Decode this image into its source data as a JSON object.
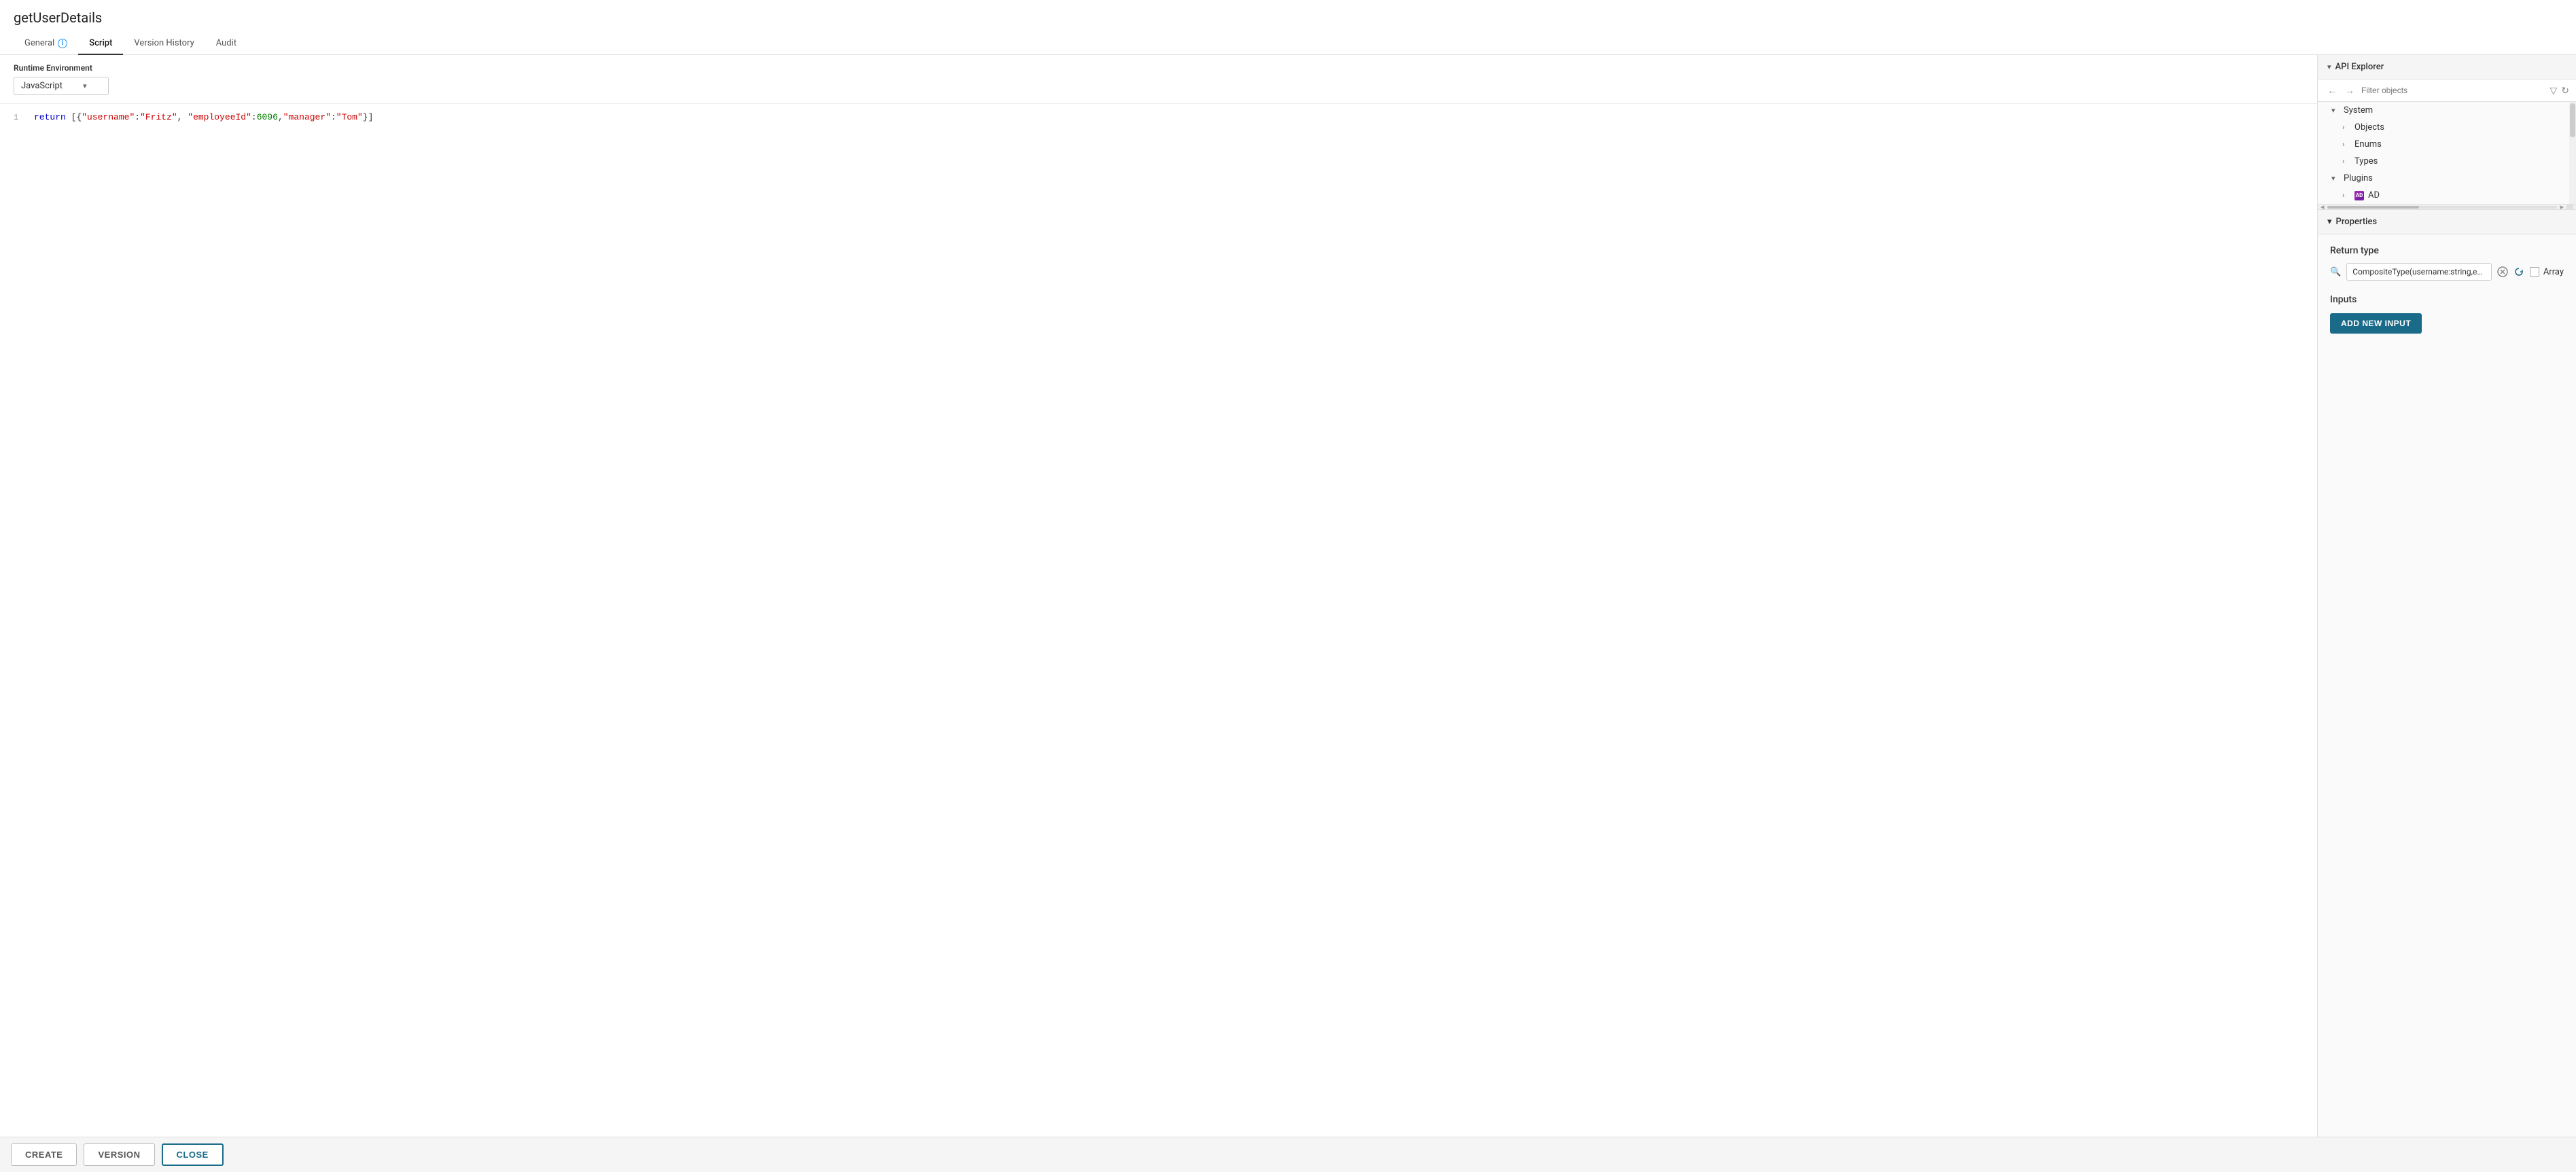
{
  "page": {
    "title": "getUserDetails"
  },
  "tabs": [
    {
      "id": "general",
      "label": "General",
      "hasInfo": true,
      "active": false
    },
    {
      "id": "script",
      "label": "Script",
      "hasInfo": false,
      "active": true
    },
    {
      "id": "version-history",
      "label": "Version History",
      "hasInfo": false,
      "active": false
    },
    {
      "id": "audit",
      "label": "Audit",
      "hasInfo": false,
      "active": false
    }
  ],
  "editor": {
    "runtime_label": "Runtime Environment",
    "runtime_value": "JavaScript",
    "code_line1": "return [{\"username\":\"Fritz\",  \"employeeId\":6096,\"manager\":\"Tom\"}]"
  },
  "api_explorer": {
    "title": "API Explorer",
    "filter_placeholder": "Filter objects",
    "tree": [
      {
        "level": 0,
        "label": "System",
        "type": "group",
        "expanded": true
      },
      {
        "level": 1,
        "label": "Objects",
        "type": "item"
      },
      {
        "level": 1,
        "label": "Enums",
        "type": "item"
      },
      {
        "level": 1,
        "label": "Types",
        "type": "item"
      },
      {
        "level": 0,
        "label": "Plugins",
        "type": "group",
        "expanded": true
      },
      {
        "level": 1,
        "label": "AD",
        "type": "item",
        "hasIcon": true
      }
    ]
  },
  "properties": {
    "title": "Properties",
    "return_type_label": "Return type",
    "return_type_value": "CompositeType(username:string,employeeId:number,manager:strin",
    "array_label": "Array",
    "inputs_label": "Inputs",
    "add_input_btn": "ADD NEW INPUT"
  },
  "footer": {
    "create_btn": "CREATE",
    "version_btn": "VERSION",
    "close_btn": "CLOSE"
  }
}
